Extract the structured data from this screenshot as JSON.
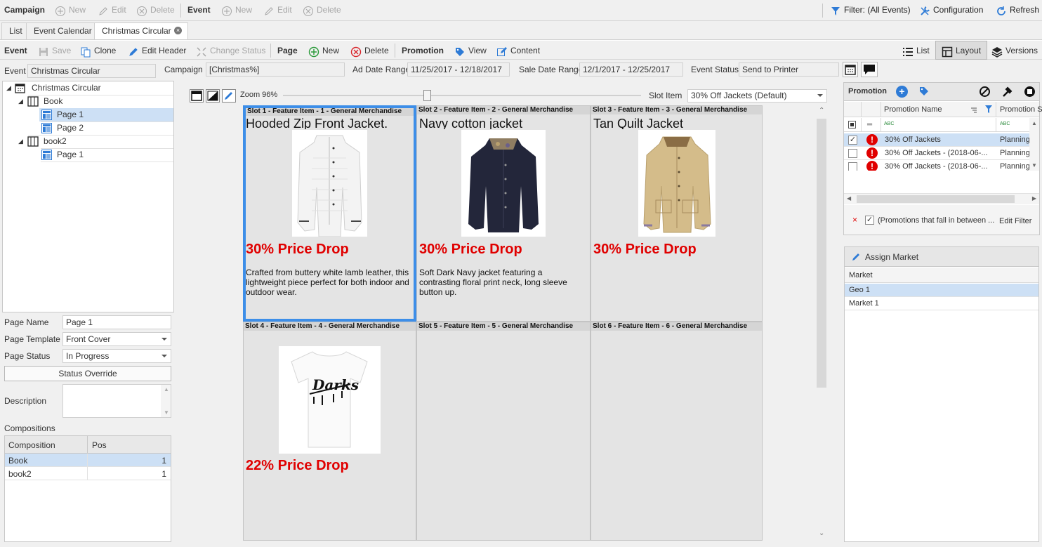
{
  "toolbar1": {
    "campaign_label": "Campaign",
    "campaign_new": "New",
    "campaign_edit": "Edit",
    "campaign_delete": "Delete",
    "event_label": "Event",
    "event_new": "New",
    "event_edit": "Edit",
    "event_delete": "Delete",
    "filter": "Filter: (All Events)",
    "configuration": "Configuration",
    "refresh": "Refresh"
  },
  "tabs": [
    {
      "label": "List"
    },
    {
      "label": "Event Calendar"
    },
    {
      "label": "Christmas Circular"
    }
  ],
  "toolbar2": {
    "event_label": "Event",
    "save": "Save",
    "clone": "Clone",
    "edit_header": "Edit Header",
    "change_status": "Change Status",
    "page_label": "Page",
    "page_new": "New",
    "page_delete": "Delete",
    "promotion_label": "Promotion",
    "view": "View",
    "content": "Content",
    "list": "List",
    "layout": "Layout",
    "versions": "Versions"
  },
  "header_fields": {
    "event_label": "Event",
    "event_value": "Christmas Circular",
    "campaign_label": "Campaign",
    "campaign_value": "[Christmas%]",
    "ad_date_label": "Ad Date Range",
    "ad_date_value": "11/25/2017 - 12/18/2017",
    "sale_date_label": "Sale Date Range",
    "sale_date_value": "12/1/2017 - 12/25/2017",
    "status_label": "Event Status",
    "status_value": "Send to Printer"
  },
  "tree": [
    {
      "label": "Christmas Circular"
    },
    {
      "label": "Book"
    },
    {
      "label": "Page 1"
    },
    {
      "label": "Page 2"
    },
    {
      "label": "book2"
    },
    {
      "label": "Page 1"
    }
  ],
  "page_props": {
    "name_label": "Page Name",
    "name_value": "Page 1",
    "template_label": "Page Template",
    "template_value": "Front Cover",
    "status_label": "Page Status",
    "status_value": "In Progress",
    "override_button": "Status Override",
    "description_label": "Description",
    "compositions_label": "Compositions",
    "comp_col1": "Composition",
    "comp_col2": "Pos",
    "compositions": [
      {
        "name": "Book",
        "pos": "1"
      },
      {
        "name": "book2",
        "pos": "1"
      }
    ]
  },
  "canvas": {
    "zoom_label": "Zoom 96%",
    "zoom_value": 0.4,
    "slot_item_label": "Slot Item",
    "slot_item_value": "30% Off Jackets (Default)"
  },
  "slots": [
    {
      "header": "Slot 1 - Feature Item - 1 - General Merchandise",
      "title": "Hooded Zip Front Jacket.",
      "price": "30% Price Drop",
      "desc": "Crafted from buttery white lamb leather, this lightweight piece perfect for both indoor and outdoor wear."
    },
    {
      "header": "Slot 2 - Feature Item - 2 - General Merchandise",
      "title": "Navy cotton jacket",
      "price": "30% Price Drop",
      "desc": "Soft Dark Navy jacket featuring a contrasting floral print neck, long sleeve button up."
    },
    {
      "header": "Slot 3 - Feature Item - 3 - General Merchandise",
      "title": "Tan Quilt Jacket",
      "price": "30% Price Drop",
      "desc": ""
    },
    {
      "header": "Slot 4 - Feature Item - 4 - General Merchandise",
      "title": "",
      "price": "22% Price Drop",
      "desc": ""
    },
    {
      "header": "Slot 5 - Feature Item - 5 - General Merchandise",
      "title": "",
      "price": "",
      "desc": ""
    },
    {
      "header": "Slot 6 - Feature Item - 6 - General Merchandise",
      "title": "",
      "price": "",
      "desc": ""
    }
  ],
  "promotion_panel": {
    "title": "Promotion",
    "col_name": "Promotion Name",
    "col_status": "Promotion S",
    "filter_abc": "ABC",
    "rows": [
      {
        "name": "30% Off Jackets",
        "status": "Planning",
        "checked": true
      },
      {
        "name": "30% Off Jackets - (2018-06-...",
        "status": "Planning",
        "checked": false
      },
      {
        "name": "30% Off Jackets - (2018-06-...",
        "status": "Planning",
        "checked": false
      }
    ],
    "filter_text": "(Promotions that fall in between ...",
    "edit_filter": "Edit Filter"
  },
  "market_panel": {
    "title": "Assign Market",
    "col": "Market",
    "rows": [
      {
        "name": "Geo 1"
      },
      {
        "name": "Market 1"
      }
    ]
  },
  "colors": {
    "accent_blue": "#3d8ee8",
    "price_red": "#e00000",
    "selection": "#cde0f5"
  }
}
